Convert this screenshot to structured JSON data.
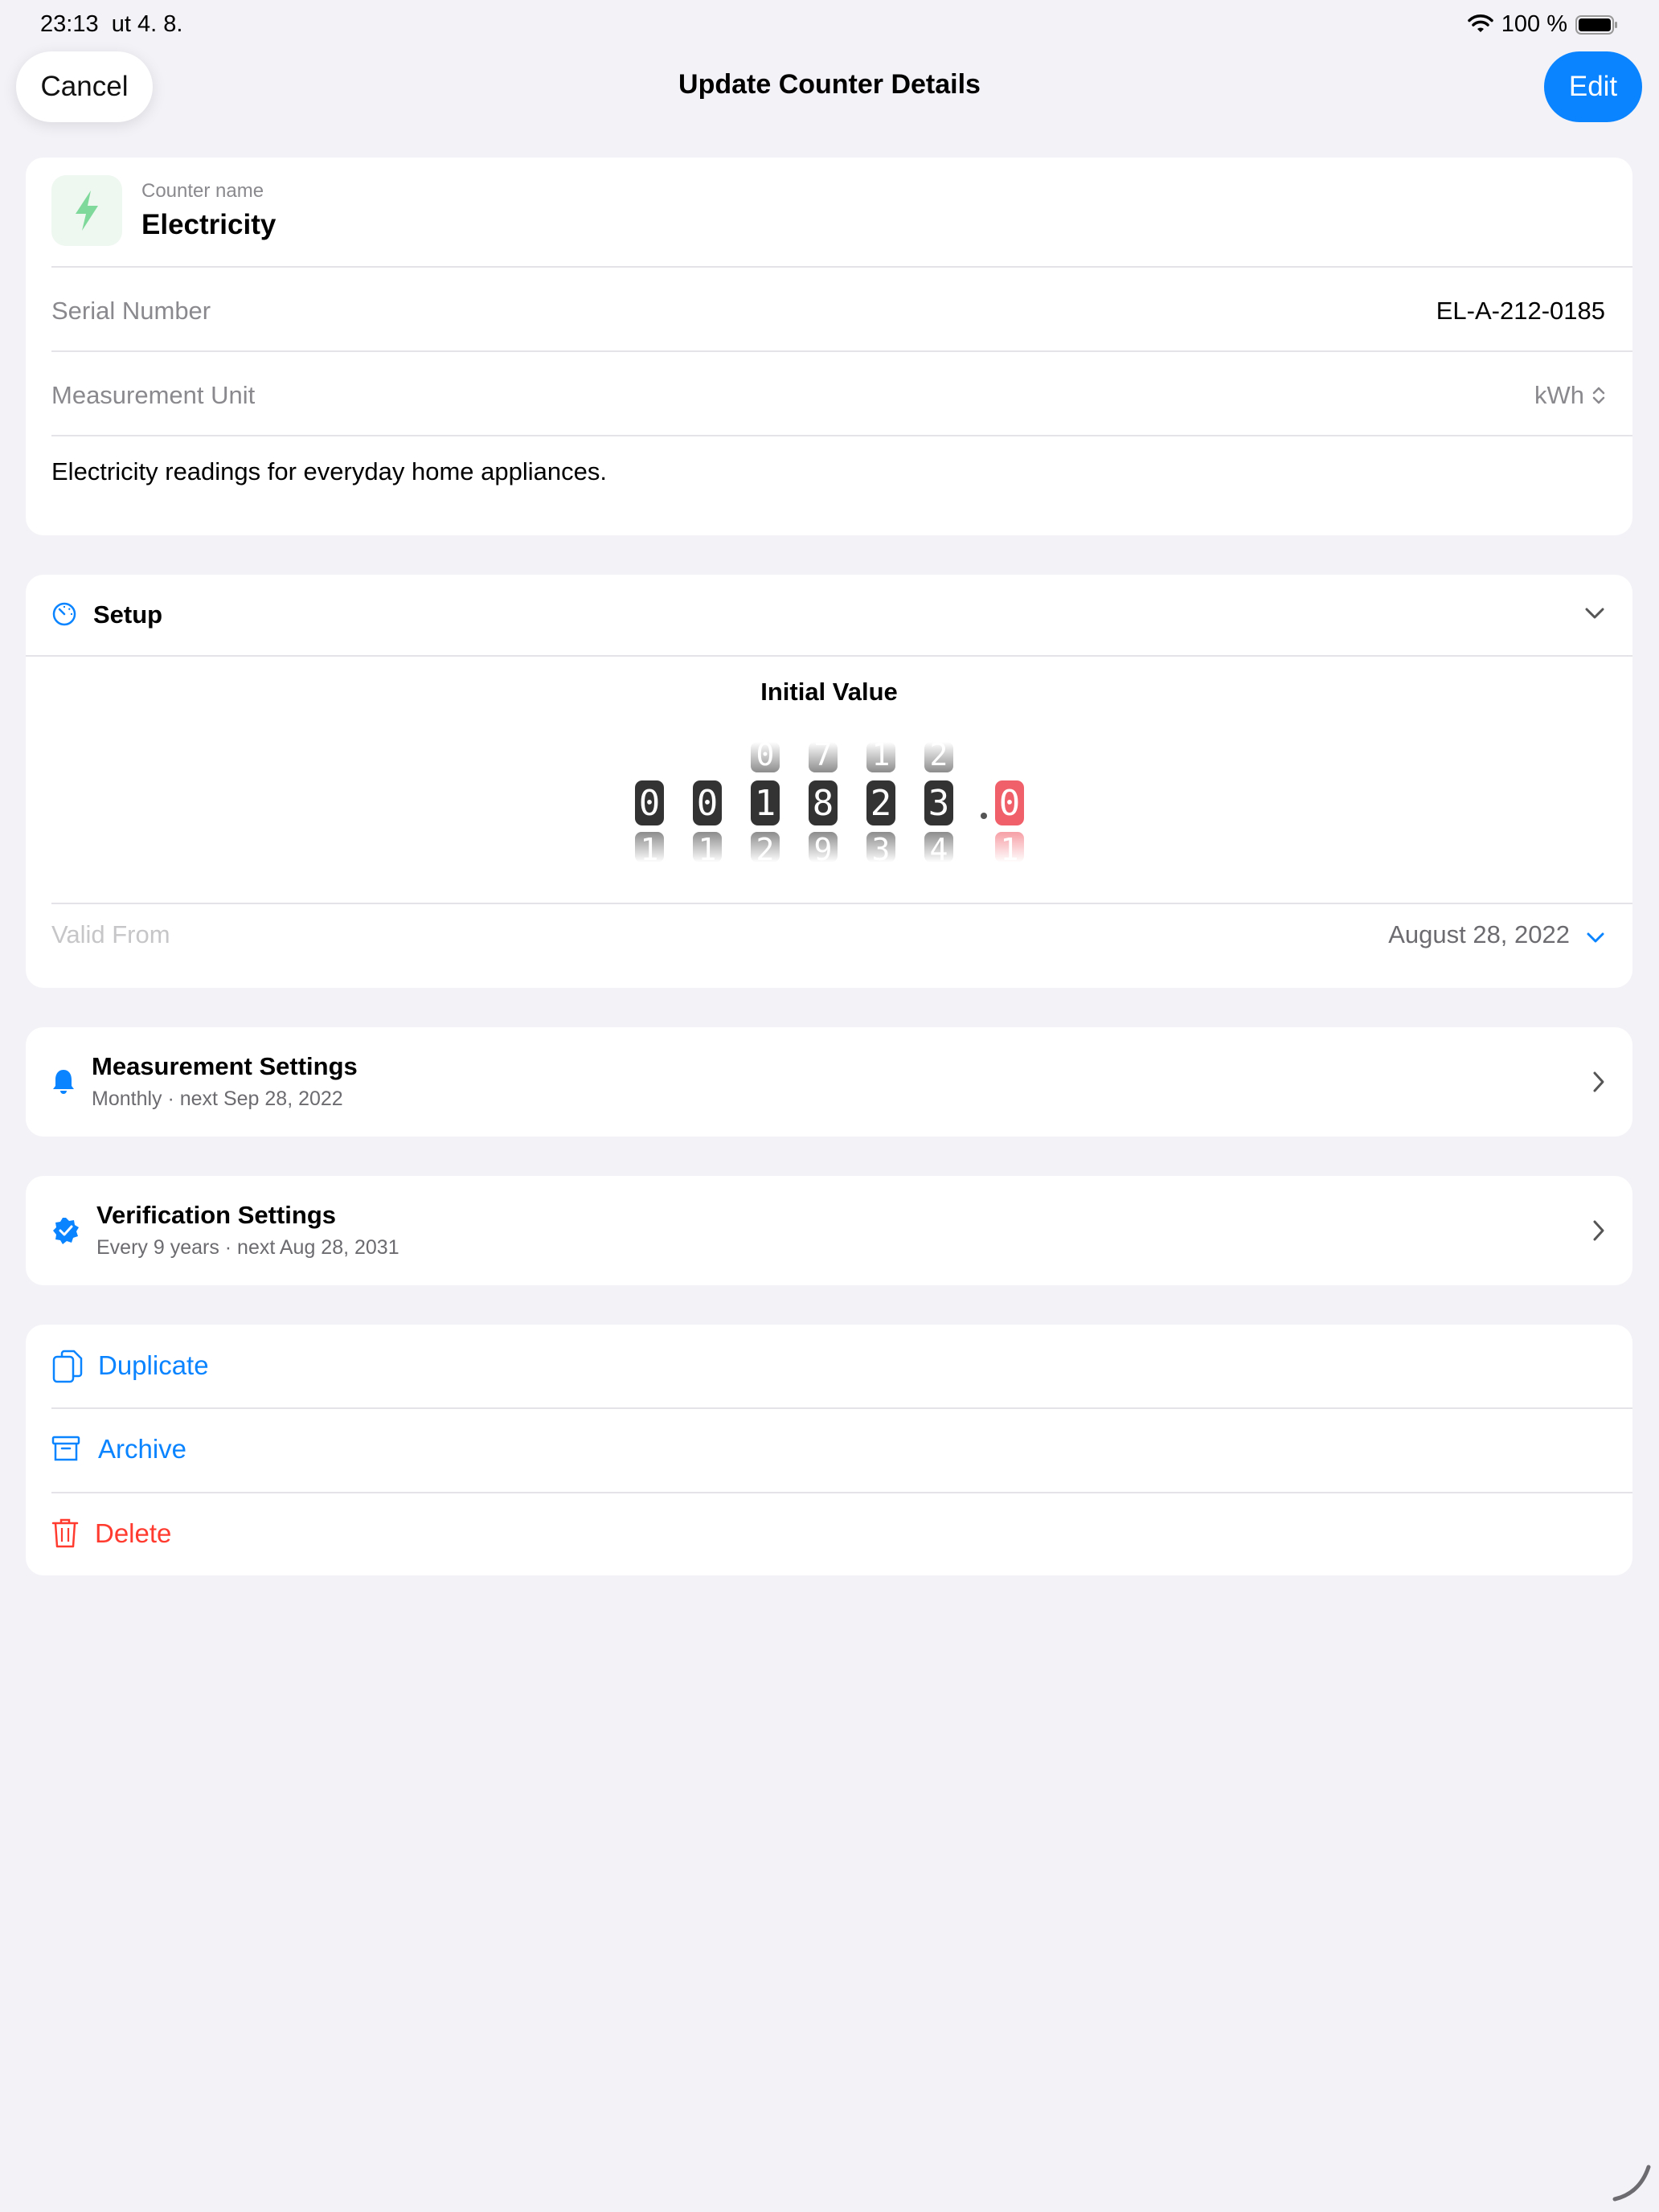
{
  "status_bar": {
    "time": "23:13",
    "date": "ut 4. 8.",
    "battery": "100 %"
  },
  "nav": {
    "cancel_label": "Cancel",
    "title": "Update Counter Details",
    "edit_label": "Edit"
  },
  "counter": {
    "name_caption": "Counter name",
    "name": "Electricity",
    "icon": "bolt-icon",
    "serial_label": "Serial Number",
    "serial_value": "EL-A-212-0185",
    "unit_label": "Measurement Unit",
    "unit_value": "kWh",
    "description": "Electricity readings for everyday home appliances."
  },
  "setup": {
    "title": "Setup",
    "initial_value_title": "Initial Value",
    "digits": [
      "0",
      "0",
      "1",
      "8",
      "2",
      "3"
    ],
    "digits_above": [
      "",
      "",
      "0",
      "7",
      "1",
      "2"
    ],
    "digits_below": [
      "1",
      "1",
      "2",
      "9",
      "3",
      "4"
    ],
    "decimal_digit": "0",
    "decimal_below": "1",
    "valid_from_label": "Valid From",
    "valid_from_value": "August 28, 2022"
  },
  "measurement_settings": {
    "title": "Measurement Settings",
    "subtitle": "Monthly · next Sep 28, 2022"
  },
  "verification_settings": {
    "title": "Verification Settings",
    "subtitle": "Every 9 years · next Aug 28, 2031"
  },
  "actions": {
    "duplicate": "Duplicate",
    "archive": "Archive",
    "delete": "Delete"
  },
  "colors": {
    "accent": "#0A84FF",
    "destructive": "#FF3B30",
    "bolt": "#34C759",
    "background": "#F2F2F7"
  }
}
